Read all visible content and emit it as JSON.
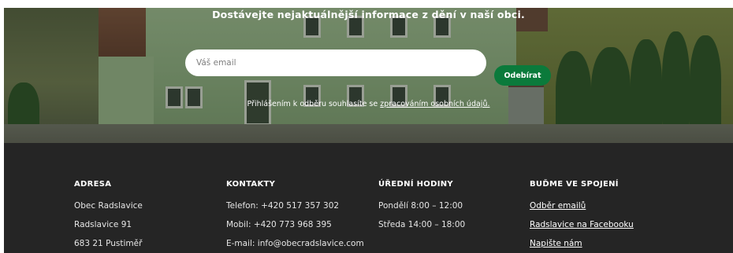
{
  "newsletter": {
    "headline": "Dostávejte nejaktuálnější informace z dění v naší obci.",
    "email_placeholder": "Váš email",
    "subscribe_label": "Odebírat",
    "consent_text": "Přihlášením k odběru souhlasíte se ",
    "consent_link": "zpracováním osobních údajů."
  },
  "footer": {
    "address": {
      "heading": "ADRESA",
      "lines": [
        "Obec Radslavice",
        "Radslavice 91",
        "683 21 Pustiměř"
      ]
    },
    "contacts": {
      "heading": "KONTAKTY",
      "lines": [
        "Telefon: +420 517 357 302",
        "Mobil: +420 773 968 395",
        "E-mail: info@obecradslavice.com"
      ]
    },
    "office_hours": {
      "heading": "ÚŘEDNÍ HODINY",
      "lines": [
        "Pondělí 8:00 – 12:00",
        "Středa 14:00 – 18:00"
      ]
    },
    "social": {
      "heading": "BUĎME VE SPOJENÍ",
      "links": [
        "Odběr emailů",
        "Radslavice na Facebooku",
        "Napište nám"
      ]
    }
  },
  "colors": {
    "accent_green": "#0b7a3b",
    "footer_bg": "#252525"
  }
}
